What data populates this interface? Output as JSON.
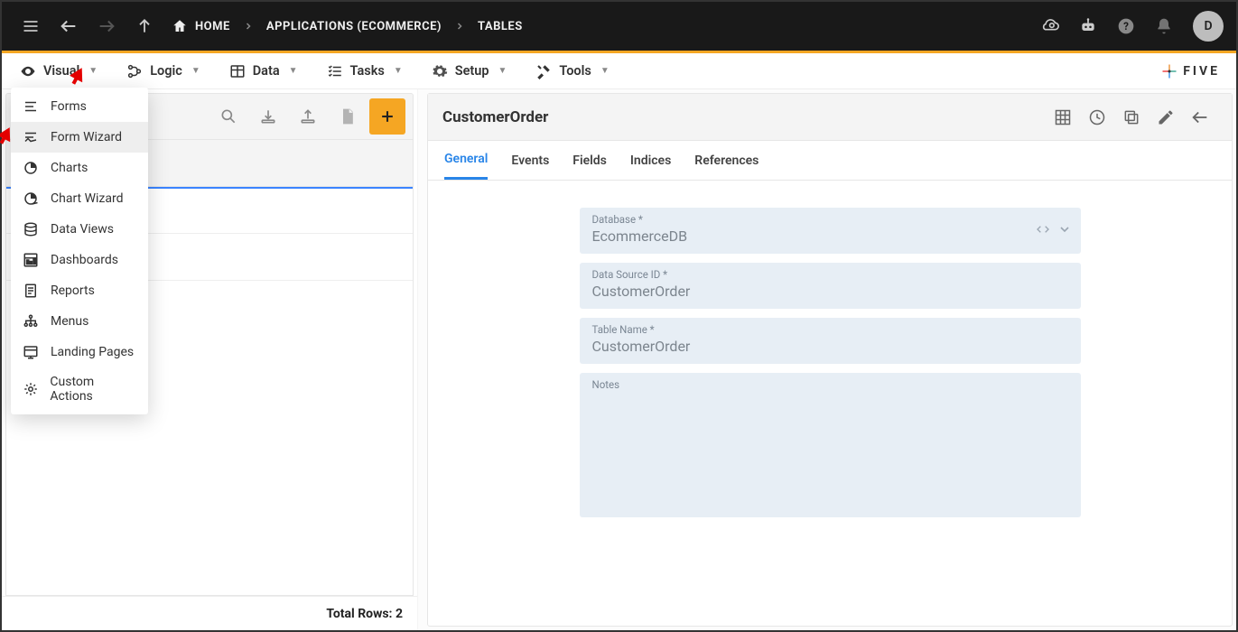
{
  "topbar": {
    "breadcrumb": [
      {
        "label": "HOME",
        "icon": "home"
      },
      {
        "label": "APPLICATIONS (ECOMMERCE)",
        "icon": null
      },
      {
        "label": "TABLES",
        "icon": null
      }
    ],
    "avatar_letter": "D"
  },
  "menubar": {
    "items": [
      {
        "label": "Visual",
        "icon": "eye"
      },
      {
        "label": "Logic",
        "icon": "branch"
      },
      {
        "label": "Data",
        "icon": "db"
      },
      {
        "label": "Tasks",
        "icon": "list"
      },
      {
        "label": "Setup",
        "icon": "gear"
      },
      {
        "label": "Tools",
        "icon": "tools"
      }
    ],
    "brand": "FIVE"
  },
  "visual_dropdown": {
    "items": [
      {
        "label": "Forms"
      },
      {
        "label": "Form Wizard"
      },
      {
        "label": "Charts"
      },
      {
        "label": "Chart Wizard"
      },
      {
        "label": "Data Views"
      },
      {
        "label": "Dashboards"
      },
      {
        "label": "Reports"
      },
      {
        "label": "Menus"
      },
      {
        "label": "Landing Pages"
      },
      {
        "label": "Custom Actions"
      }
    ]
  },
  "list": {
    "total_label": "Total Rows: 2"
  },
  "detail": {
    "title": "CustomerOrder",
    "tabs": [
      {
        "label": "General"
      },
      {
        "label": "Events"
      },
      {
        "label": "Fields"
      },
      {
        "label": "Indices"
      },
      {
        "label": "References"
      }
    ],
    "fields": {
      "database": {
        "label": "Database *",
        "value": "EcommerceDB"
      },
      "dsid": {
        "label": "Data Source ID *",
        "value": "CustomerOrder"
      },
      "tablename": {
        "label": "Table Name *",
        "value": "CustomerOrder"
      },
      "notes": {
        "label": "Notes",
        "value": ""
      }
    }
  }
}
